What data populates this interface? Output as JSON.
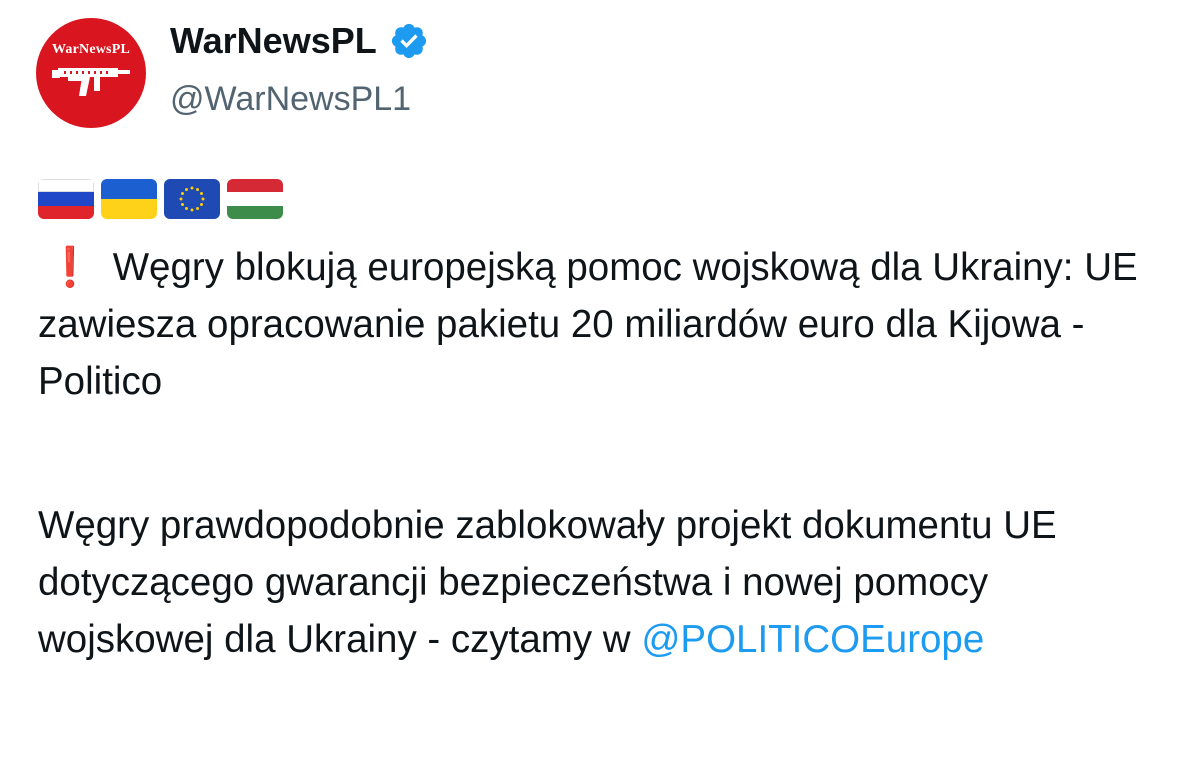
{
  "author": {
    "name": "WarNewsPL",
    "handle": "@WarNewsPL1",
    "avatar_text": "WarNewsPL",
    "verified_icon": "verified-badge-icon"
  },
  "flags": [
    {
      "name": "russia-flag-icon",
      "colors": [
        "#ffffff",
        "#1f47c8",
        "#e0242c"
      ]
    },
    {
      "name": "ukraine-flag-icon",
      "colors": [
        "#1b5fd1",
        "#ffd21a"
      ]
    },
    {
      "name": "eu-flag-icon",
      "colors": [
        "#1f49b3",
        "#ffcc00"
      ]
    },
    {
      "name": "hungary-flag-icon",
      "colors": [
        "#d52a36",
        "#ffffff",
        "#3e8c4a"
      ]
    }
  ],
  "post": {
    "alert_icon": "❗",
    "paragraph1": "Węgry blokują europejską pomoc wojskową dla Ukrainy: UE zawiesza opracowanie pakietu 20 miliardów euro dla Kijowa - Politico",
    "paragraph2": "Węgry prawdopodobnie zablokowały projekt dokumentu UE dotyczącego gwarancji bezpieczeństwa i nowej pomocy wojskowej dla Ukrainy - czytamy w",
    "mention": "@POLITICOEurope"
  },
  "colors": {
    "link": "#1d9bf0",
    "verified": "#1d9bf0",
    "avatar_bg": "#d9161f"
  }
}
